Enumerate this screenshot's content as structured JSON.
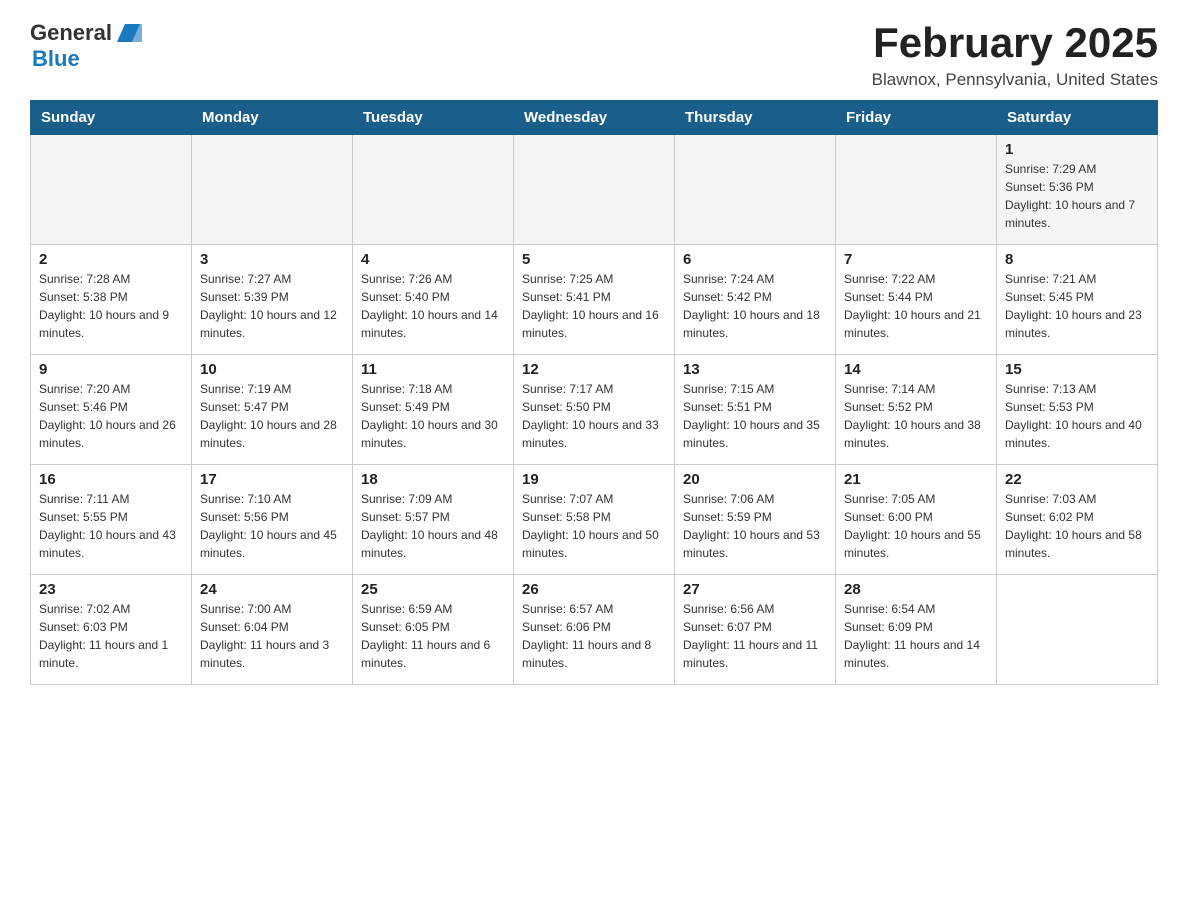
{
  "logo": {
    "general": "General",
    "blue": "Blue"
  },
  "header": {
    "title": "February 2025",
    "location": "Blawnox, Pennsylvania, United States"
  },
  "days_of_week": [
    "Sunday",
    "Monday",
    "Tuesday",
    "Wednesday",
    "Thursday",
    "Friday",
    "Saturday"
  ],
  "weeks": [
    [
      {
        "day": "",
        "info": ""
      },
      {
        "day": "",
        "info": ""
      },
      {
        "day": "",
        "info": ""
      },
      {
        "day": "",
        "info": ""
      },
      {
        "day": "",
        "info": ""
      },
      {
        "day": "",
        "info": ""
      },
      {
        "day": "1",
        "info": "Sunrise: 7:29 AM\nSunset: 5:36 PM\nDaylight: 10 hours and 7 minutes."
      }
    ],
    [
      {
        "day": "2",
        "info": "Sunrise: 7:28 AM\nSunset: 5:38 PM\nDaylight: 10 hours and 9 minutes."
      },
      {
        "day": "3",
        "info": "Sunrise: 7:27 AM\nSunset: 5:39 PM\nDaylight: 10 hours and 12 minutes."
      },
      {
        "day": "4",
        "info": "Sunrise: 7:26 AM\nSunset: 5:40 PM\nDaylight: 10 hours and 14 minutes."
      },
      {
        "day": "5",
        "info": "Sunrise: 7:25 AM\nSunset: 5:41 PM\nDaylight: 10 hours and 16 minutes."
      },
      {
        "day": "6",
        "info": "Sunrise: 7:24 AM\nSunset: 5:42 PM\nDaylight: 10 hours and 18 minutes."
      },
      {
        "day": "7",
        "info": "Sunrise: 7:22 AM\nSunset: 5:44 PM\nDaylight: 10 hours and 21 minutes."
      },
      {
        "day": "8",
        "info": "Sunrise: 7:21 AM\nSunset: 5:45 PM\nDaylight: 10 hours and 23 minutes."
      }
    ],
    [
      {
        "day": "9",
        "info": "Sunrise: 7:20 AM\nSunset: 5:46 PM\nDaylight: 10 hours and 26 minutes."
      },
      {
        "day": "10",
        "info": "Sunrise: 7:19 AM\nSunset: 5:47 PM\nDaylight: 10 hours and 28 minutes."
      },
      {
        "day": "11",
        "info": "Sunrise: 7:18 AM\nSunset: 5:49 PM\nDaylight: 10 hours and 30 minutes."
      },
      {
        "day": "12",
        "info": "Sunrise: 7:17 AM\nSunset: 5:50 PM\nDaylight: 10 hours and 33 minutes."
      },
      {
        "day": "13",
        "info": "Sunrise: 7:15 AM\nSunset: 5:51 PM\nDaylight: 10 hours and 35 minutes."
      },
      {
        "day": "14",
        "info": "Sunrise: 7:14 AM\nSunset: 5:52 PM\nDaylight: 10 hours and 38 minutes."
      },
      {
        "day": "15",
        "info": "Sunrise: 7:13 AM\nSunset: 5:53 PM\nDaylight: 10 hours and 40 minutes."
      }
    ],
    [
      {
        "day": "16",
        "info": "Sunrise: 7:11 AM\nSunset: 5:55 PM\nDaylight: 10 hours and 43 minutes."
      },
      {
        "day": "17",
        "info": "Sunrise: 7:10 AM\nSunset: 5:56 PM\nDaylight: 10 hours and 45 minutes."
      },
      {
        "day": "18",
        "info": "Sunrise: 7:09 AM\nSunset: 5:57 PM\nDaylight: 10 hours and 48 minutes."
      },
      {
        "day": "19",
        "info": "Sunrise: 7:07 AM\nSunset: 5:58 PM\nDaylight: 10 hours and 50 minutes."
      },
      {
        "day": "20",
        "info": "Sunrise: 7:06 AM\nSunset: 5:59 PM\nDaylight: 10 hours and 53 minutes."
      },
      {
        "day": "21",
        "info": "Sunrise: 7:05 AM\nSunset: 6:00 PM\nDaylight: 10 hours and 55 minutes."
      },
      {
        "day": "22",
        "info": "Sunrise: 7:03 AM\nSunset: 6:02 PM\nDaylight: 10 hours and 58 minutes."
      }
    ],
    [
      {
        "day": "23",
        "info": "Sunrise: 7:02 AM\nSunset: 6:03 PM\nDaylight: 11 hours and 1 minute."
      },
      {
        "day": "24",
        "info": "Sunrise: 7:00 AM\nSunset: 6:04 PM\nDaylight: 11 hours and 3 minutes."
      },
      {
        "day": "25",
        "info": "Sunrise: 6:59 AM\nSunset: 6:05 PM\nDaylight: 11 hours and 6 minutes."
      },
      {
        "day": "26",
        "info": "Sunrise: 6:57 AM\nSunset: 6:06 PM\nDaylight: 11 hours and 8 minutes."
      },
      {
        "day": "27",
        "info": "Sunrise: 6:56 AM\nSunset: 6:07 PM\nDaylight: 11 hours and 11 minutes."
      },
      {
        "day": "28",
        "info": "Sunrise: 6:54 AM\nSunset: 6:09 PM\nDaylight: 11 hours and 14 minutes."
      },
      {
        "day": "",
        "info": ""
      }
    ]
  ]
}
